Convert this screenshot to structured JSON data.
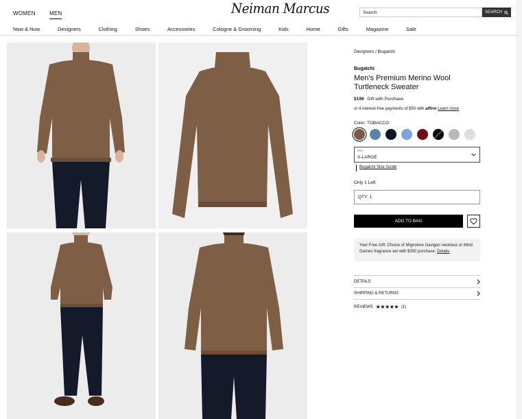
{
  "header": {
    "gender_tabs": [
      "WOMEN",
      "MEN"
    ],
    "logo": "Neiman Marcus",
    "search_placeholder": "Search",
    "search_button": "SEARCH",
    "nav": [
      "Now & Now",
      "Designers",
      "Clothing",
      "Shoes",
      "Accessories",
      "Cologne & Grooming",
      "Kids",
      "Home",
      "Gifts",
      "Magazine",
      "Sale"
    ]
  },
  "product": {
    "breadcrumb": "Designers / Bugatchi",
    "brand": "Bugatchi",
    "title_line1": "Men's Premium Merino Wool",
    "title_line2": "Turtleneck Sweater",
    "price": "$199",
    "gift_text": "Gift with Purchase",
    "installments_text": "or 4 interest-free payments of $50 with",
    "affirm": "affirm",
    "learn_more": "Learn more",
    "color_label": "Color: TOBACCO",
    "swatch_colors": [
      "#7a5a43",
      "#5f83a6",
      "#101522",
      "#7fa4d6",
      "#6e0f14",
      "#0c0c0c",
      "#b9b9b9",
      "#dedede"
    ],
    "size_label": "Size",
    "size_value": "X-LARGE",
    "size_guide": "Bugatchi Size Guide",
    "stock": "Only 1 Left",
    "qty": "QTY: 1",
    "add_to_bag": "ADD TO BAG",
    "promo_text": "Your Free Gift: Choice of Mignonne Gavigan necklace or Mind Games fragrance set with $350 purchase.",
    "promo_details": "Details",
    "details": "DETAILS",
    "shipping": "SHIPPING & RETURNS",
    "reviews": "REVIEWS",
    "stars": "★★★★★",
    "review_count": "(1)"
  },
  "colors": {
    "sweater": "#7e5e45",
    "pants": "#141a2a",
    "bg": "#ececec"
  }
}
